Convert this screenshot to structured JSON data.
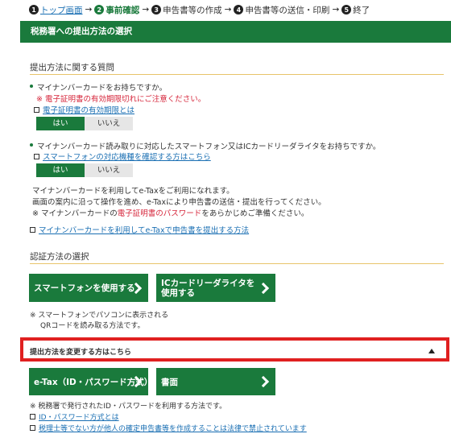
{
  "steps": [
    {
      "num": "1",
      "label": "トップ画面"
    },
    {
      "num": "2",
      "label": "事前確認"
    },
    {
      "num": "3",
      "label": "申告書等の作成"
    },
    {
      "num": "4",
      "label": "申告書等の送信・印刷"
    },
    {
      "num": "5",
      "label": "終了"
    }
  ],
  "arrow": "→",
  "banner_title": "税務署への提出方法の選択",
  "section1_title": "提出方法に関する質問",
  "q1": {
    "text": "マイナンバーカードをお持ちですか。",
    "note_mark": "※",
    "note": "電子証明書の有効期限切れにご注意ください。",
    "link": "電子証明書の有効期限とは",
    "yes": "はい",
    "no": "いいえ"
  },
  "q2": {
    "text": "マイナンバーカード読み取りに対応したスマートフォン又はICカードリーダライタをお持ちですか。",
    "link": "スマートフォンの対応機種を確認する方はこちら",
    "yes": "はい",
    "no": "いいえ"
  },
  "info": {
    "line1": "マイナンバーカードを利用してe-Taxをご利用になれます。",
    "line2": "画面の案内に沿って操作を進め、e-Taxにより申告書の送信・提出を行ってください。",
    "line3_pre": "※  マイナンバーカードの",
    "line3_red": "電子証明書のパスワード",
    "line3_post": "をあらかじめご準備ください。",
    "link": "マイナンバーカードを利用してe-Taxで申告書を提出する方法"
  },
  "section2_title": "認証方法の選択",
  "btn_smartphone": "スマートフォンを使用する",
  "btn_icreader_1": "ICカードリーダライタを",
  "btn_icreader_2": "使用する",
  "smart_note_1": "※  スマートフォンでパソコンに表示される",
  "smart_note_2": "QRコードを読み取る方法です。",
  "change_title": "提出方法を変更する方はこちら",
  "btn_etax_id": "e-Tax（ID・パスワード方式）",
  "btn_paper": "書面",
  "id_note": "※  税務署で発行されたID・パスワードを利用する方法です。",
  "link_id": "ID・パスワード方式とは",
  "link_tax": "税理士等でない方が他人の確定申告書等を作成することは法律で禁止されています"
}
